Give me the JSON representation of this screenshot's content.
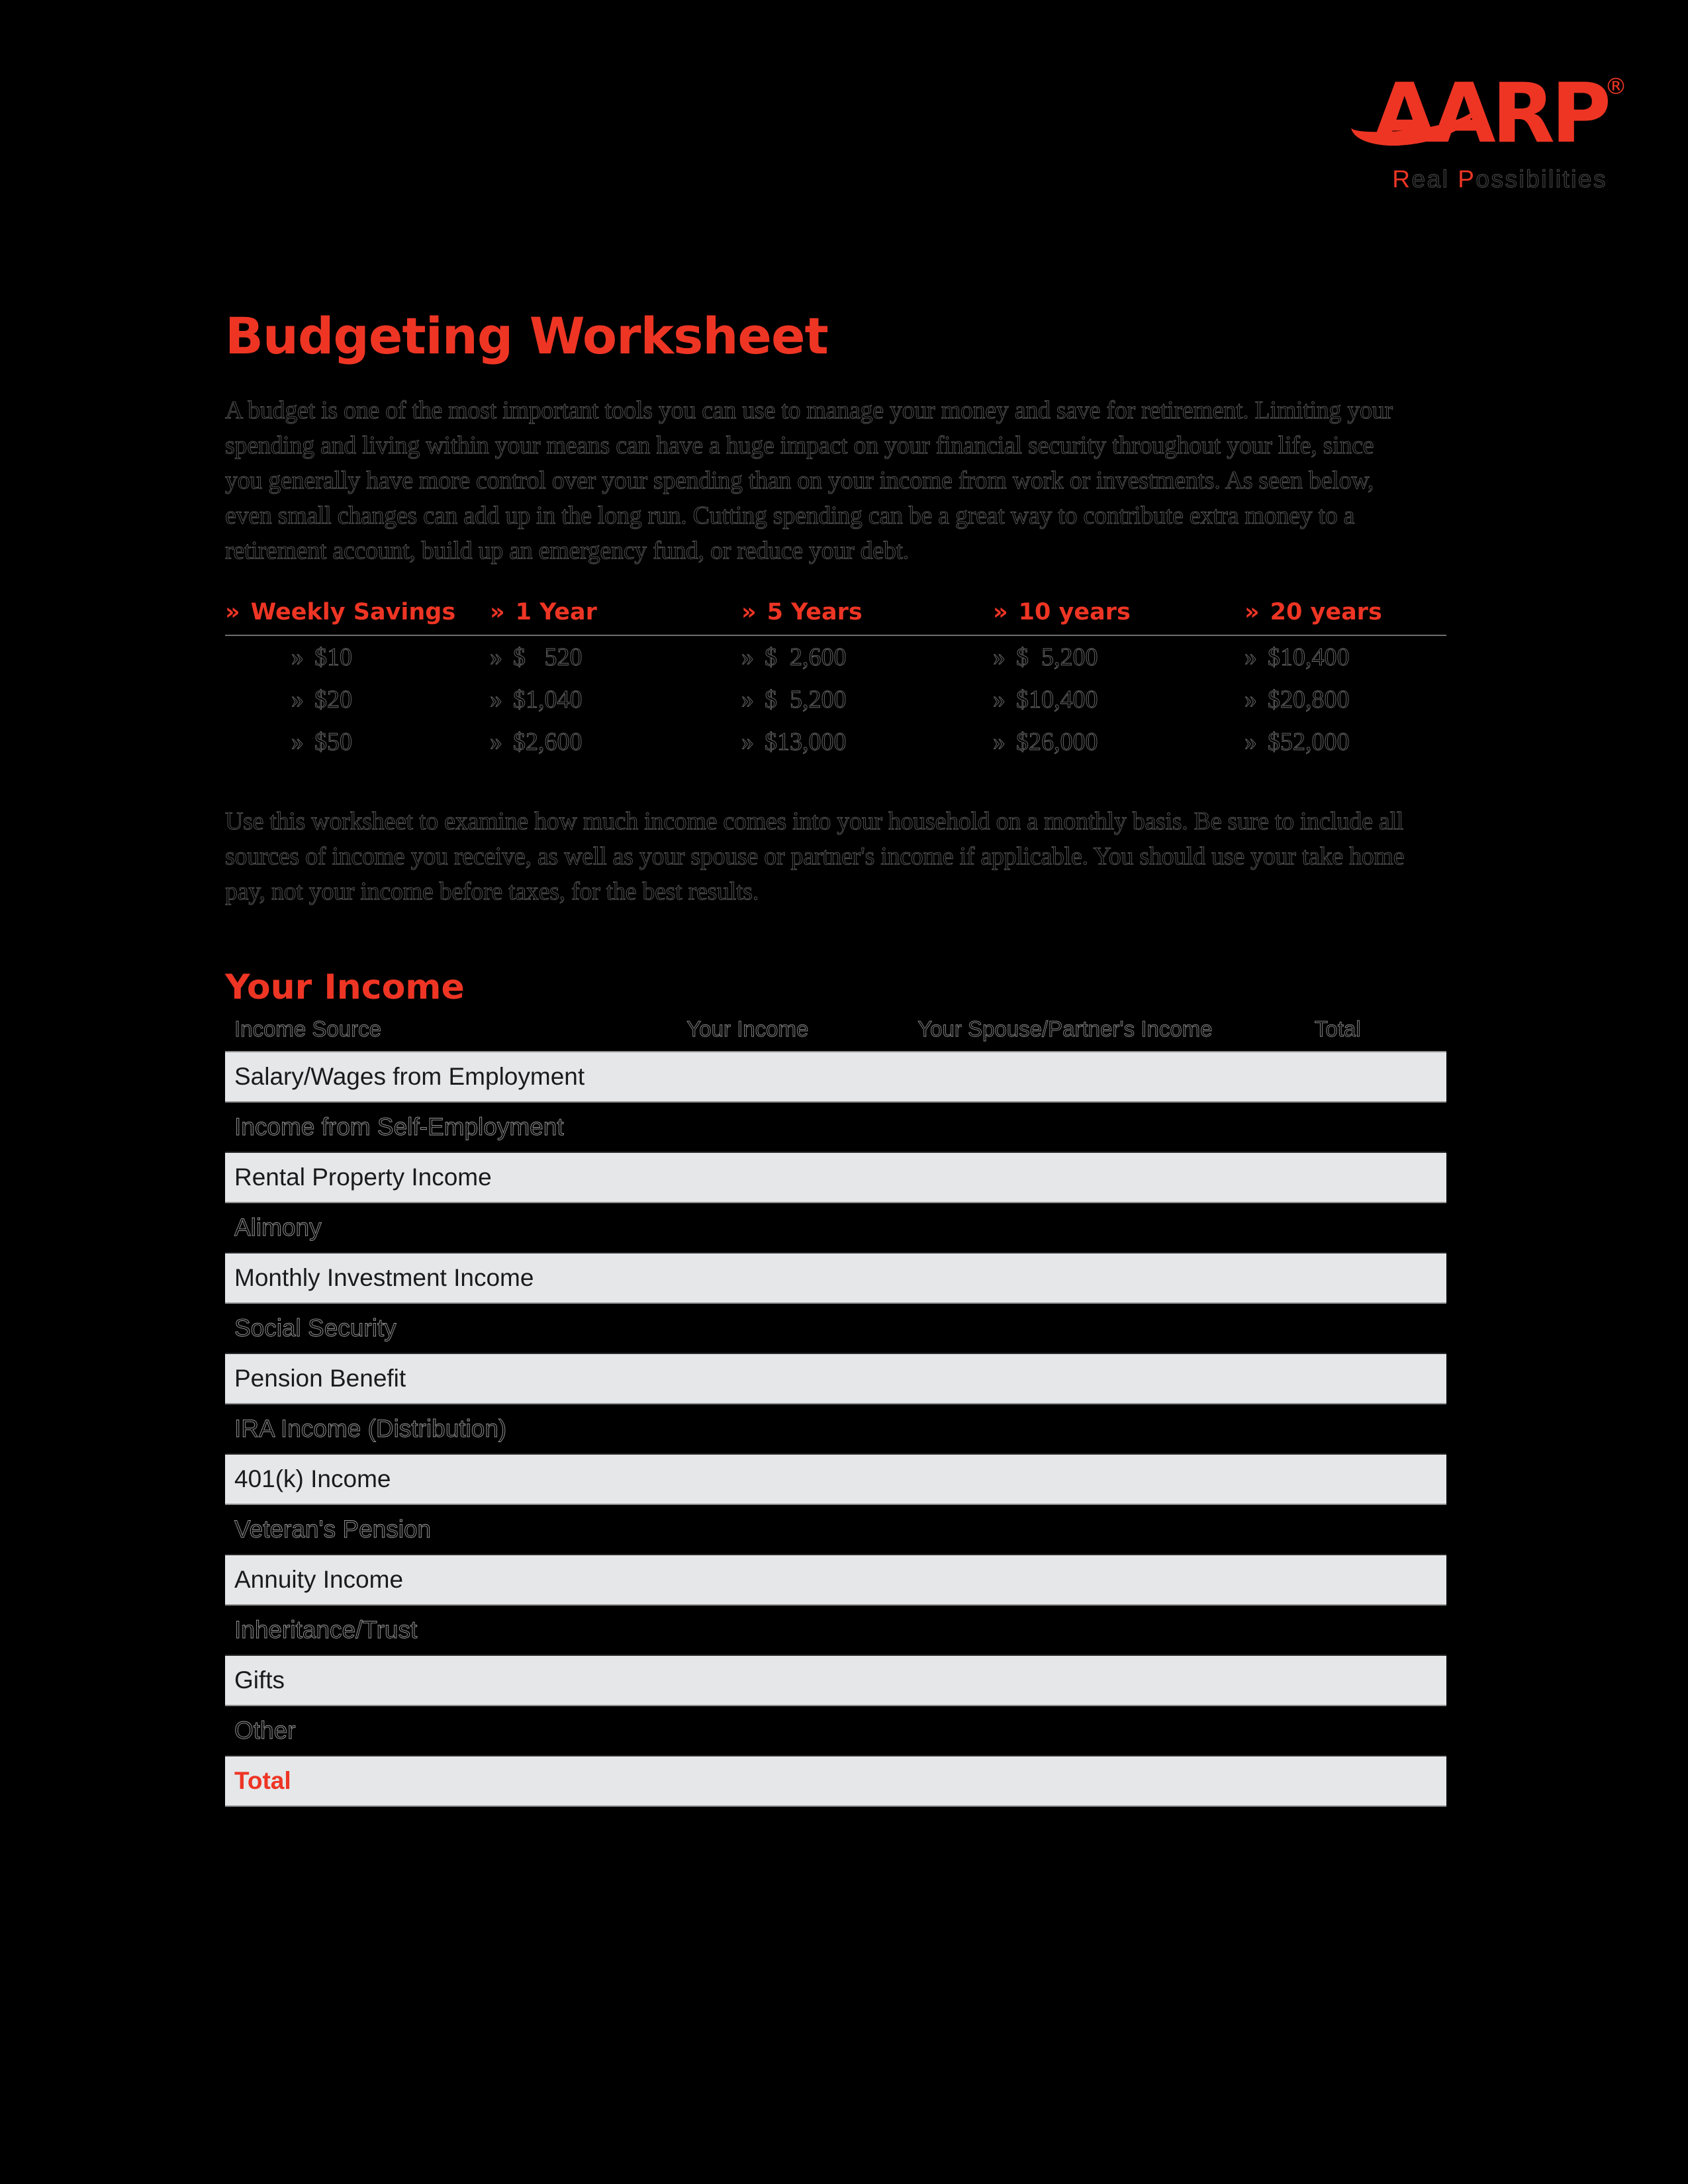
{
  "brand": {
    "wordmark": "AARP",
    "registered": "®",
    "tagline_red": "R",
    "tagline_rest": "eal ",
    "tagline_red2": "P",
    "tagline_rest2": "ossibilities"
  },
  "title": "Budgeting Worksheet",
  "intro_paragraph": "A budget is one of the most important tools you can use to manage your money and save for retirement.  Limiting your spending and living within your means can have a huge impact on your financial security throughout your life, since you generally have more control over your spending than on your income from work or investments.  As seen below, even small changes can add up in the long run.  Cutting spending can be a great way to contribute extra money to a retirement account, build up an emergency fund, or reduce your debt.",
  "second_paragraph": "Use this worksheet to examine how much income comes into your household on a monthly basis. Be sure to include all sources of income you receive, as well as your spouse or partner's income  if applicable.  You should use your take home pay, not your income before taxes, for the best results.",
  "chart_data": {
    "type": "table",
    "title": "Weekly Savings Growth",
    "bullet": "»",
    "categories": [
      "Weekly Savings",
      "1 Year",
      "5 Years",
      "10 years",
      "20 years"
    ],
    "rows": [
      {
        "weekly": "$10",
        "y1": "$   520",
        "y5": "$  2,600",
        "y10": "$  5,200",
        "y20": "$10,400"
      },
      {
        "weekly": "$20",
        "y1": "$1,040",
        "y5": "$  5,200",
        "y10": "$10,400",
        "y20": "$20,800"
      },
      {
        "weekly": "$50",
        "y1": "$2,600",
        "y5": "$13,000",
        "y10": "$26,000",
        "y20": "$52,000"
      }
    ],
    "values": {
      "weekly": [
        10,
        20,
        50
      ],
      "year1": [
        520,
        1040,
        2600
      ],
      "year5": [
        2600,
        5200,
        13000
      ],
      "year10": [
        5200,
        10400,
        26000
      ],
      "year20": [
        10400,
        20800,
        52000
      ]
    }
  },
  "income": {
    "section_title": "Your Income",
    "headers": {
      "source": "Income Source",
      "your_income": "Your Income",
      "spouse_income": "Your Spouse/Partner's Income",
      "total": "Total"
    },
    "rows": [
      {
        "label": "Salary/Wages from Employment",
        "style": "light"
      },
      {
        "label": "Income from Self-Employment",
        "style": "dark"
      },
      {
        "label": "Rental Property Income",
        "style": "light"
      },
      {
        "label": "Alimony",
        "style": "dark"
      },
      {
        "label": "Monthly Investment Income",
        "style": "light"
      },
      {
        "label": "Social Security",
        "style": "dark"
      },
      {
        "label": "Pension Benefit",
        "style": "light"
      },
      {
        "label": "IRA Income (Distribution)",
        "style": "dark"
      },
      {
        "label": "401(k) Income",
        "style": "light"
      },
      {
        "label": "Veteran's Pension",
        "style": "dark"
      },
      {
        "label": "Annuity Income",
        "style": "light"
      },
      {
        "label": "Inheritance/Trust",
        "style": "dark"
      },
      {
        "label": "Gifts",
        "style": "light"
      },
      {
        "label": "Other",
        "style": "dark"
      },
      {
        "label": "Total",
        "style": "total"
      }
    ]
  },
  "colors": {
    "brand_red": "#ee3524",
    "row_light": "#e5e7e9",
    "page_bg": "#000000"
  }
}
